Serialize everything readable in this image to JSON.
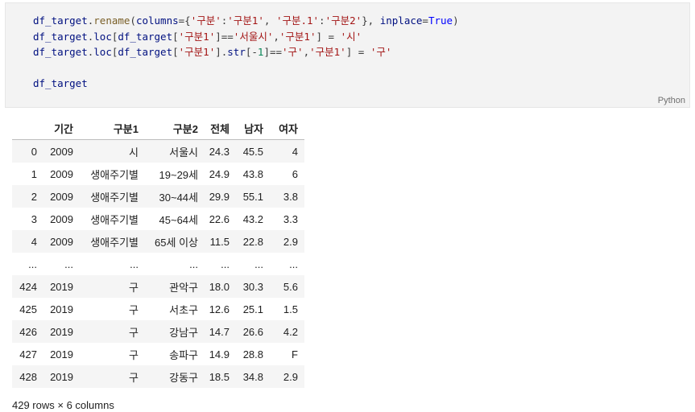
{
  "code_cell": {
    "lines": [
      [
        {
          "t": "df_target",
          "c": "var"
        },
        {
          "t": ".",
          "c": "op"
        },
        {
          "t": "rename",
          "c": "fn"
        },
        {
          "t": "(",
          "c": "op"
        },
        {
          "t": "columns",
          "c": "var"
        },
        {
          "t": "={",
          "c": "op"
        },
        {
          "t": "'구분'",
          "c": "str"
        },
        {
          "t": ":",
          "c": "op"
        },
        {
          "t": "'구분1'",
          "c": "str"
        },
        {
          "t": ", ",
          "c": "op"
        },
        {
          "t": "'구분.1'",
          "c": "str"
        },
        {
          "t": ":",
          "c": "op"
        },
        {
          "t": "'구분2'",
          "c": "str"
        },
        {
          "t": "}, ",
          "c": "op"
        },
        {
          "t": "inplace",
          "c": "var"
        },
        {
          "t": "=",
          "c": "op"
        },
        {
          "t": "True",
          "c": "kw"
        },
        {
          "t": ")",
          "c": "op"
        }
      ],
      [
        {
          "t": "df_target",
          "c": "var"
        },
        {
          "t": ".",
          "c": "op"
        },
        {
          "t": "loc",
          "c": "var"
        },
        {
          "t": "[",
          "c": "op"
        },
        {
          "t": "df_target",
          "c": "var"
        },
        {
          "t": "[",
          "c": "op"
        },
        {
          "t": "'구분1'",
          "c": "str"
        },
        {
          "t": "]==",
          "c": "op"
        },
        {
          "t": "'서울시'",
          "c": "str"
        },
        {
          "t": ",",
          "c": "op"
        },
        {
          "t": "'구분1'",
          "c": "str"
        },
        {
          "t": "] = ",
          "c": "op"
        },
        {
          "t": "'시'",
          "c": "str"
        }
      ],
      [
        {
          "t": "df_target",
          "c": "var"
        },
        {
          "t": ".",
          "c": "op"
        },
        {
          "t": "loc",
          "c": "var"
        },
        {
          "t": "[",
          "c": "op"
        },
        {
          "t": "df_target",
          "c": "var"
        },
        {
          "t": "[",
          "c": "op"
        },
        {
          "t": "'구분1'",
          "c": "str"
        },
        {
          "t": "].",
          "c": "op"
        },
        {
          "t": "str",
          "c": "var"
        },
        {
          "t": "[-",
          "c": "op"
        },
        {
          "t": "1",
          "c": "num"
        },
        {
          "t": "]==",
          "c": "op"
        },
        {
          "t": "'구'",
          "c": "str"
        },
        {
          "t": ",",
          "c": "op"
        },
        {
          "t": "'구분1'",
          "c": "str"
        },
        {
          "t": "] = ",
          "c": "op"
        },
        {
          "t": "'구'",
          "c": "str"
        }
      ],
      [],
      [
        {
          "t": "df_target",
          "c": "var"
        }
      ]
    ],
    "language": "Python"
  },
  "dataframe": {
    "columns": [
      "",
      "기간",
      "구분1",
      "구분2",
      "전체",
      "남자",
      "여자"
    ],
    "rows": [
      [
        "0",
        "2009",
        "시",
        "서울시",
        "24.3",
        "45.5",
        "4"
      ],
      [
        "1",
        "2009",
        "생애주기별",
        "19~29세",
        "24.9",
        "43.8",
        "6"
      ],
      [
        "2",
        "2009",
        "생애주기별",
        "30~44세",
        "29.9",
        "55.1",
        "3.8"
      ],
      [
        "3",
        "2009",
        "생애주기별",
        "45~64세",
        "22.6",
        "43.2",
        "3.3"
      ],
      [
        "4",
        "2009",
        "생애주기별",
        "65세 이상",
        "11.5",
        "22.8",
        "2.9"
      ],
      [
        "...",
        "...",
        "...",
        "...",
        "...",
        "...",
        "..."
      ],
      [
        "424",
        "2019",
        "구",
        "관악구",
        "18.0",
        "30.3",
        "5.6"
      ],
      [
        "425",
        "2019",
        "구",
        "서초구",
        "12.6",
        "25.1",
        "1.5"
      ],
      [
        "426",
        "2019",
        "구",
        "강남구",
        "14.7",
        "26.6",
        "4.2"
      ],
      [
        "427",
        "2019",
        "구",
        "송파구",
        "14.9",
        "28.8",
        "F"
      ],
      [
        "428",
        "2019",
        "구",
        "강동구",
        "18.5",
        "34.8",
        "2.9"
      ]
    ],
    "shape_text": "429 rows × 6 columns"
  }
}
